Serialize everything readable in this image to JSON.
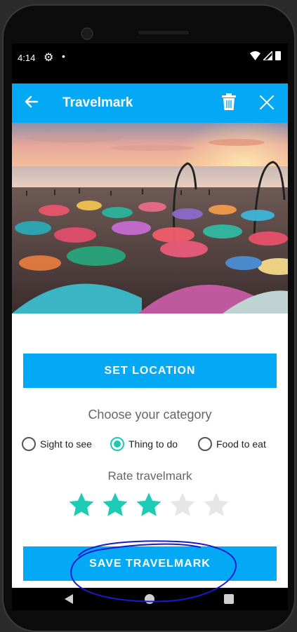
{
  "status_bar": {
    "time": "4:14",
    "icons": [
      "gear-icon",
      "notification-dot-icon",
      "wifi-icon",
      "signal-icon",
      "battery-icon"
    ]
  },
  "app_bar": {
    "title": "Travelmark",
    "icons": [
      "back-arrow-icon",
      "trash-icon",
      "close-icon"
    ],
    "color": "#03A9F4"
  },
  "main": {
    "set_location_label": "SET LOCATION",
    "category_prompt": "Choose your category",
    "categories": [
      {
        "label": "Sight to see",
        "selected": false
      },
      {
        "label": "Thing to do",
        "selected": true
      },
      {
        "label": "Food to eat",
        "selected": false
      }
    ],
    "rating_prompt": "Rate travelmark",
    "rating": {
      "value": 3,
      "max": 5
    },
    "save_label": "SAVE TRAVELMARK"
  },
  "colors": {
    "accent": "#03A9F4",
    "selected": "#1EC8B4",
    "star_filled": "#1ECBB6",
    "star_empty": "#E6E6E6",
    "annotation": "#1A1ACC"
  },
  "nav_bar": {
    "icons": [
      "nav-back-icon",
      "nav-home-icon",
      "nav-recents-icon"
    ]
  }
}
